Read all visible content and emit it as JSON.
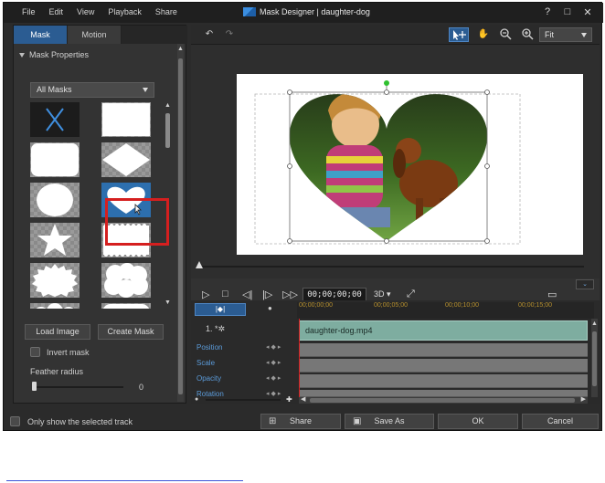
{
  "window": {
    "title": "Mask Designer  |  daughter-dog",
    "menu": [
      "File",
      "Edit",
      "View",
      "Playback",
      "Share"
    ],
    "controls": [
      "?",
      "□",
      "✕"
    ]
  },
  "left_panel": {
    "tabs": [
      {
        "label": "Mask"
      },
      {
        "label": "Motion"
      }
    ],
    "section_title": "Mask Properties",
    "mask_filter": "All Masks",
    "load_image_label": "Load Image",
    "create_mask_label": "Create Mask",
    "invert_mask_label": "Invert mask",
    "feather_label": "Feather radius",
    "feather_value": "0",
    "feather_fraction": 0.0
  },
  "toolbar": {
    "undo": "↶",
    "redo": "↷",
    "fit_label": "Fit"
  },
  "playback": {
    "timecode": "00;00;00;00",
    "mode_3d": "3D"
  },
  "timeline": {
    "ruler": [
      "00;00;00;00",
      "00;00;05;00",
      "00;00;10;00",
      "00;00;15;00"
    ],
    "track_number": "1.",
    "clip_name": "daughter-dog.mp4",
    "properties": [
      "Position",
      "Scale",
      "Opacity",
      "Rotation"
    ]
  },
  "footer": {
    "only_selected_label": "Only show the selected track",
    "share_label": "Share",
    "save_as_label": "Save As",
    "ok_label": "OK",
    "cancel_label": "Cancel"
  },
  "colors": {
    "accent": "#2b5c92",
    "selection": "#d51f1f",
    "clip": "#7eada0",
    "ruler_text": "#b8912e",
    "property_label": "#5b9bd9"
  }
}
